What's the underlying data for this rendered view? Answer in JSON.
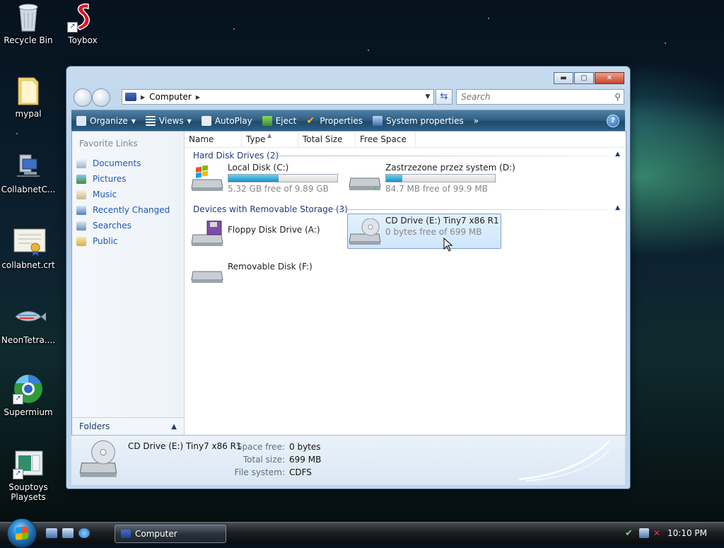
{
  "desktop": {
    "icons": [
      {
        "label": "Recycle Bin"
      },
      {
        "label": "Toybox"
      },
      {
        "label": "mypal"
      },
      {
        "label": "CollabnetC..."
      },
      {
        "label": "collabnet.crt"
      },
      {
        "label": "NeonTetra...."
      },
      {
        "label": "Supermium"
      },
      {
        "label": "Souptoys Playsets"
      }
    ]
  },
  "window": {
    "address_path": "Computer",
    "search_placeholder": "Search",
    "toolbar": {
      "organize": "Organize",
      "views": "Views",
      "autoplay": "AutoPlay",
      "eject": "Eject",
      "properties": "Properties",
      "system_properties": "System properties",
      "more": "»"
    },
    "nav_pane": {
      "title": "Favorite Links",
      "items": [
        "Documents",
        "Pictures",
        "Music",
        "Recently Changed",
        "Searches",
        "Public"
      ],
      "folders_label": "Folders"
    },
    "columns": [
      "Name",
      "Type",
      "Total Size",
      "Free Space"
    ],
    "groups": [
      {
        "title": "Hard Disk Drives (2)",
        "drives": [
          {
            "name": "Local Disk (C:)",
            "free_text": "5.32 GB free of 9.89 GB",
            "used_fraction": 0.46
          },
          {
            "name": "Zastrzezone przez system (D:)",
            "free_text": "84.7 MB free of 99.9 MB",
            "used_fraction": 0.15
          }
        ]
      },
      {
        "title": "Devices with Removable Storage (3)",
        "drives": [
          {
            "name": "Floppy Disk Drive (A:)"
          },
          {
            "name": "CD Drive (E:) Tiny7 x86 R1",
            "free_text": "0 bytes free of 699 MB"
          },
          {
            "name": "Removable Disk (F:)"
          }
        ]
      }
    ],
    "details": {
      "name": "CD Drive (E:) Tiny7 x86 R1",
      "space_free_label": "Space free:",
      "space_free": "0 bytes",
      "total_size_label": "Total size:",
      "total_size": "699 MB",
      "file_system_label": "File system:",
      "file_system": "CDFS"
    }
  },
  "taskbar": {
    "task_label": "Computer",
    "clock": "10:10 PM"
  },
  "colors": {
    "toolbar_top": "#4f7fa3",
    "toolbar_bottom": "#1f4a6b",
    "link_blue": "#1b58b8",
    "bar_fill": "#1d8fc2"
  }
}
